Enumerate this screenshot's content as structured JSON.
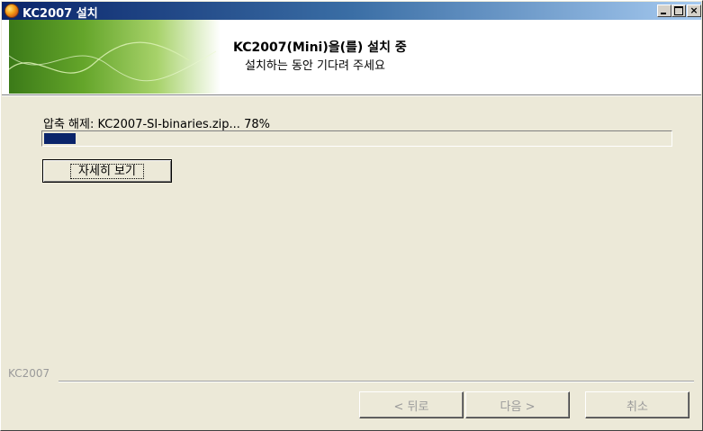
{
  "window": {
    "title": "KC2007 설치"
  },
  "header": {
    "title": "KC2007(Mini)을(를) 설치 중",
    "subtitle": "설치하는 동안 기다려 주세요"
  },
  "main": {
    "status_text": "압축 해제: KC2007-SI-binaries.zip... 78%",
    "progress_fraction": 0.05,
    "details_button_label": "자세히 보기"
  },
  "footer": {
    "brand_text": "KC2007",
    "back_label": "< 뒤로",
    "next_label": "다음 >",
    "cancel_label": "취소"
  },
  "colors": {
    "progress_fill": "#0a246a",
    "titlebar_start": "#0a246a",
    "titlebar_end": "#a6caf0",
    "banner_green": "#64a52a"
  },
  "icons": {
    "app": "installer-app-icon",
    "minimize": "minimize-icon",
    "maximize": "maximize-icon",
    "close": "close-icon"
  }
}
